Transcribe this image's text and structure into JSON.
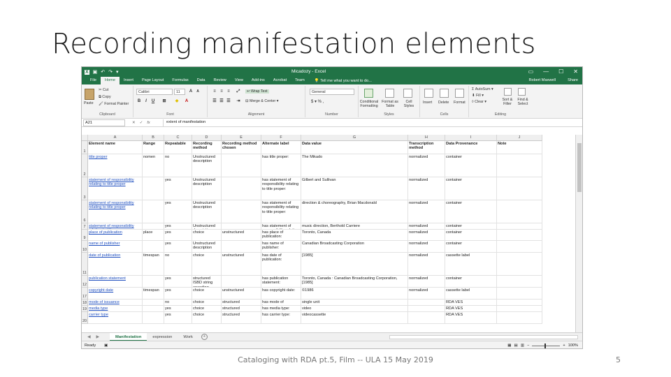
{
  "slide": {
    "title": "Recording manifestation elements",
    "footer": "Cataloging with RDA pt.5, Film -- ULA 15 May 2019",
    "page_number": "5"
  },
  "excel": {
    "document_title": "Micadozy - Excel",
    "window_buttons": [
      "▭",
      "—",
      "☐",
      "✕"
    ],
    "tabs": [
      "File",
      "Home",
      "Insert",
      "Page Layout",
      "Formulas",
      "Data",
      "Review",
      "View",
      "Add-ins",
      "Acrobat",
      "Team"
    ],
    "active_tab": "Home",
    "tell_me": "Tell me what you want to do...",
    "user": "Robert Maxwell",
    "share": "Share",
    "ribbon": {
      "clipboard": {
        "paste": "Paste",
        "cut": "Cut",
        "copy": "Copy",
        "format_painter": "Format Painter",
        "label": "Clipboard"
      },
      "font": {
        "name": "Calibri",
        "size": "11",
        "label": "Font"
      },
      "alignment": {
        "wrap": "Wrap Text",
        "merge": "Merge & Center",
        "label": "Alignment"
      },
      "number": {
        "format": "General",
        "symbols": "$ ▾ % ,",
        "label": "Number"
      },
      "styles": {
        "conditional": "Conditional Formatting",
        "format_table": "Format as Table",
        "cell_styles": "Cell Styles",
        "label": "Styles"
      },
      "cells": {
        "insert": "Insert",
        "delete": "Delete",
        "format": "Format",
        "label": "Cells"
      },
      "editing": {
        "autosum": "AutoSum",
        "fill": "Fill",
        "clear": "Clear",
        "sort": "Sort & Filter",
        "find": "Find & Select",
        "label": "Editing"
      }
    },
    "formula_bar": {
      "cell_ref": "A21",
      "content": "extent of manifestation"
    },
    "columns": [
      "A",
      "B",
      "C",
      "D",
      "E",
      "F",
      "G",
      "H",
      "I",
      "J"
    ],
    "header_row": {
      "row": "1",
      "cells": [
        "Element name",
        "Range",
        "Repeatable",
        "Recording method",
        "Recording method chosen",
        "Alternate label",
        "Data value",
        "Transcription method",
        "Data Provenance",
        "Note"
      ]
    },
    "rows": [
      {
        "num": "2",
        "cells": [
          "title proper",
          "nomen",
          "no",
          "Unstructured description",
          "",
          "has title proper:",
          "The Mikado",
          "normalized",
          "container",
          ""
        ]
      },
      {
        "num": "3",
        "cells": [
          "statement of responsibility relating to title proper",
          "",
          "yes",
          "Unstructured description",
          "",
          "has statement of responsibility relating to title proper:",
          "Gilbert and Sullivan",
          "normalized",
          "container",
          ""
        ]
      },
      {
        "num": "6",
        "cells": [
          "statement of responsibility relating to title proper",
          "",
          "yes",
          "Unstructured description",
          "",
          "has statement of responsibility relating to title proper:",
          "direction & choreography, Brian Macdonald",
          "normalized",
          "container",
          ""
        ]
      },
      {
        "num": "7",
        "cells": [
          "statement of responsibility relating to title proper",
          "",
          "yes",
          "Unstructured description",
          "",
          "has statement of responsibility relating to title proper:",
          "music direction, Berthold Carriere",
          "normalized",
          "container",
          ""
        ]
      },
      {
        "num": "9",
        "cells": [
          "place of publication",
          "place",
          "yes",
          "choice",
          "unstructured",
          "has place of publication:",
          "Toronto, Canada",
          "normalized",
          "container",
          ""
        ]
      },
      {
        "num": "10",
        "cells": [
          "name of publisher",
          "",
          "yes",
          "Unstructured description",
          "",
          "has name of publisher:",
          "Canadian Broadcasting Corporation",
          "normalized",
          "container",
          ""
        ]
      },
      {
        "num": "11",
        "cells": [
          "date of publication",
          "timespan",
          "no",
          "choice",
          "unstructured",
          "has date of publication:",
          "[1985]",
          "normalized",
          "cassette label",
          ""
        ]
      },
      {
        "num": "12",
        "cells": [
          "publication statement",
          "",
          "yes",
          "structured ISBD string encoding scheme",
          "",
          "has publication statement:",
          "Toronto, Canada : Canadian Broadcasting Corporation, [1985]",
          "normalized",
          "container",
          ""
        ]
      },
      {
        "num": "17",
        "cells": [
          "copyright date",
          "timespan",
          "yes",
          "choice",
          "unstructured",
          "has copyright date:",
          "©1986",
          "normalized",
          "cassette label",
          ""
        ]
      },
      {
        "num": "18",
        "cells": [
          "mode of issuance",
          "",
          "no",
          "choice",
          "structured",
          "has mode of issuance:",
          "single unit",
          "",
          "RDA VES",
          ""
        ]
      },
      {
        "num": "19",
        "cells": [
          "media type",
          "",
          "yes",
          "choice",
          "structured",
          "has media type:",
          "video",
          "",
          "RDA VES",
          ""
        ]
      },
      {
        "num": "20",
        "cells": [
          "carrier type",
          "",
          "yes",
          "choice",
          "structured",
          "has carrier type:",
          "videocassette",
          "",
          "RDA VES",
          ""
        ]
      }
    ],
    "sheet_tabs": [
      "Manifestation",
      "expression",
      "Work"
    ],
    "active_sheet": "Manifestation",
    "status": "Ready",
    "zoom": "100%"
  }
}
